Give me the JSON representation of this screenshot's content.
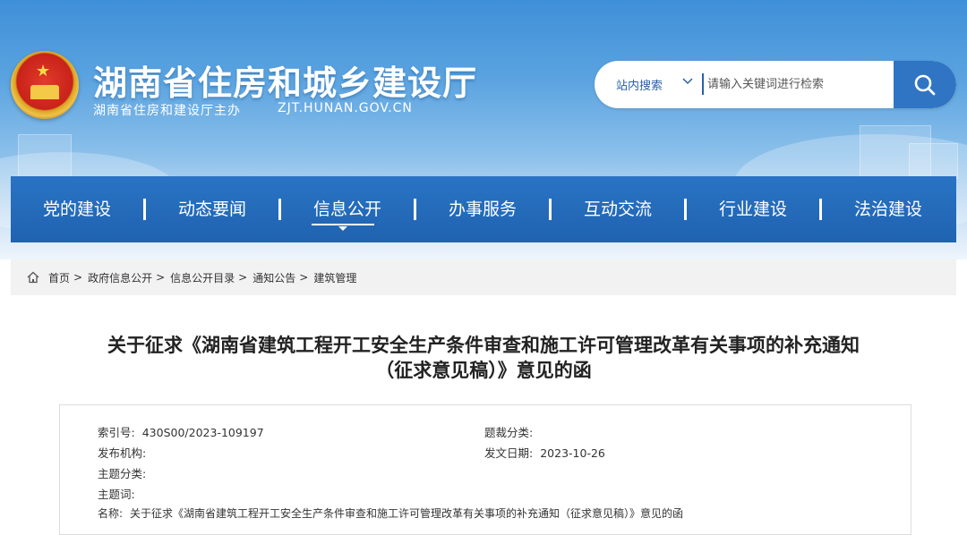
{
  "header": {
    "site_title": "湖南省住房和城乡建设厅",
    "sponsor": "湖南省住房和建设厅主办",
    "domain": "ZJT.HUNAN.GOV.CN"
  },
  "search": {
    "scope": "站内搜索",
    "placeholder": "请输入关键词进行检索"
  },
  "nav": {
    "items": [
      {
        "label": "党的建设"
      },
      {
        "label": "动态要闻"
      },
      {
        "label": "信息公开"
      },
      {
        "label": "办事服务"
      },
      {
        "label": "互动交流"
      },
      {
        "label": "行业建设"
      },
      {
        "label": "法治建设"
      }
    ],
    "active_index": 2
  },
  "breadcrumb": {
    "items": [
      "首页",
      "政府信息公开",
      "信息公开目录",
      "通知公告",
      "建筑管理"
    ]
  },
  "document": {
    "title_line1": "关于征求《湖南省建筑工程开工安全生产条件审查和施工许可管理改革有关事项的补充通知",
    "title_line2": "（征求意见稿）》意见的函",
    "meta": {
      "index_label": "索引号:",
      "index_value": "430S00/2023-109197",
      "genre_label": "题裁分类:",
      "genre_value": "",
      "publisher_label": "发布机构:",
      "publisher_value": "",
      "date_label": "发文日期:",
      "date_value": "2023-10-26",
      "topic_label": "主题分类:",
      "topic_value": "",
      "keywords_label": "主题词:",
      "keywords_value": "",
      "name_label": "名称:",
      "name_value": "关于征求《湖南省建筑工程开工安全生产条件审查和施工许可管理改革有关事项的补充通知（征求意见稿）》意见的函"
    }
  },
  "colors": {
    "nav_bg": "#1f63b0",
    "search_button": "#2f75c4",
    "banner_top": "#3f8fd8"
  }
}
